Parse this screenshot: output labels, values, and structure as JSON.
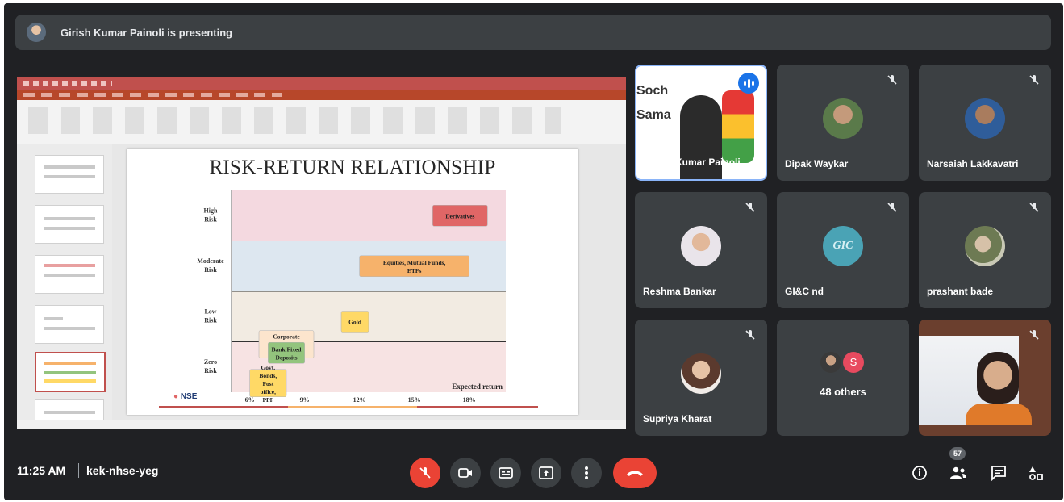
{
  "presenter_bar": {
    "text": "Girish Kumar Painoli is presenting"
  },
  "slide": {
    "title": "RISK-RETURN RELATIONSHIP",
    "logo_text": "NSE"
  },
  "chart_data": {
    "type": "table",
    "title": "RISK-RETURN RELATIONSHIP",
    "y_bands": [
      "High Risk",
      "Moderate Risk",
      "Low Risk",
      "Zero Risk"
    ],
    "x_ticks": [
      "6%",
      "9%",
      "12%",
      "15%",
      "18%"
    ],
    "xlabel": "Expected return",
    "boxes": [
      {
        "label": "Derivatives",
        "risk": "High Risk",
        "return_range": [
          "16%",
          "19%"
        ],
        "color": "#e06666"
      },
      {
        "label": "Equities, Mutual Funds, ETFs",
        "risk": "Moderate Risk",
        "return_range": [
          "12%",
          "18%"
        ],
        "color": "#f6b26b"
      },
      {
        "label": "Gold",
        "risk": "Low Risk",
        "return_range": [
          "11%",
          "12.5%"
        ],
        "color": "#ffd966"
      },
      {
        "label": "Corporate bonds, Debt Mutual funds",
        "risk": "Low Risk",
        "return_range": [
          "6.5%",
          "9.5%"
        ],
        "color": "#fce5cd"
      },
      {
        "label": "Bank Fixed Deposits",
        "risk": "Zero Risk",
        "return_range": [
          "7%",
          "9%"
        ],
        "color": "#93c47d"
      },
      {
        "label": "Govt. Bonds, Post office, PPF",
        "risk": "Zero Risk",
        "return_range": [
          "6%",
          "8%"
        ],
        "color": "#ffd966"
      }
    ],
    "band_colors": [
      "#f4d9e0",
      "#dde7f0",
      "#f2ebe2",
      "#f7e3e3"
    ]
  },
  "tiles": [
    {
      "name": "Girish Kumar Painoli",
      "muted": false,
      "speaking": true,
      "bg_words": [
        "Soch",
        "Sama"
      ]
    },
    {
      "name": "Dipak Waykar",
      "muted": true
    },
    {
      "name": "Narsaiah Lakkavatri",
      "muted": true
    },
    {
      "name": "Reshma Bankar",
      "muted": true
    },
    {
      "name": "GI&C nd",
      "muted": true,
      "avatar_text": "GIC"
    },
    {
      "name": "prashant bade",
      "muted": true
    },
    {
      "name": "Supriya Kharat",
      "muted": true
    },
    {
      "name": "48 others",
      "avatar_initial": "S"
    },
    {
      "name": "",
      "muted": true
    }
  ],
  "bottom_bar": {
    "time": "11:25 AM",
    "meeting_code": "kek-nhse-yeg",
    "participants_count": "57"
  },
  "colors": {
    "bar_bg": "#202124",
    "tile_bg": "#3c4043",
    "danger": "#ea4335",
    "accent": "#8ab4f8"
  }
}
